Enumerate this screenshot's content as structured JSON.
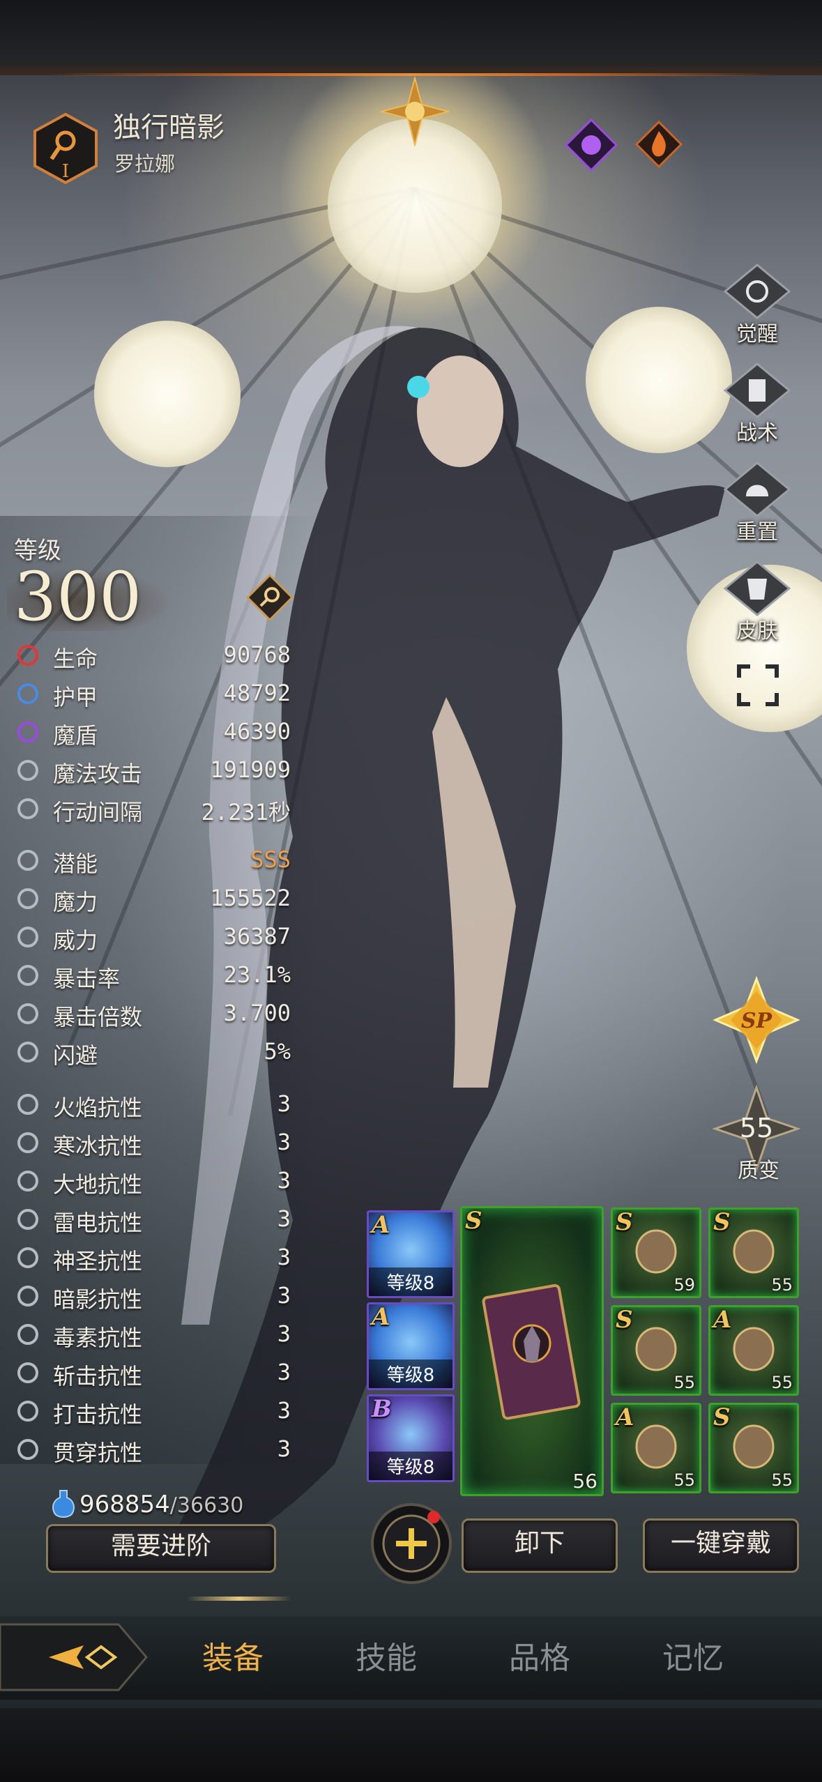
{
  "header": {
    "class_badge": "I",
    "hero_title": "独行暗影",
    "hero_name": "罗拉娜",
    "element_icons": [
      "shadow-icon",
      "fire-icon"
    ]
  },
  "side_buttons": [
    {
      "label": "觉醒",
      "icon": "sun-icon"
    },
    {
      "label": "战术",
      "icon": "tower-icon"
    },
    {
      "label": "重置",
      "icon": "helmet-icon"
    },
    {
      "label": "皮肤",
      "icon": "armor-icon"
    }
  ],
  "level": {
    "label": "等级",
    "value": "300"
  },
  "stats_primary": [
    {
      "name": "生命",
      "value": "90768",
      "icon": "health-cross-icon",
      "color": "#e0383a"
    },
    {
      "name": "护甲",
      "value": "48792",
      "icon": "shield-icon",
      "color": "#4a8ae0"
    },
    {
      "name": "魔盾",
      "value": "46390",
      "icon": "magic-shield-icon",
      "color": "#9a4ae0"
    },
    {
      "name": "魔法攻击",
      "value": "191909",
      "icon": "wand-icon",
      "color": "#b8bcc2"
    },
    {
      "name": "行动间隔",
      "value": "2.231秒",
      "icon": "wing-icon",
      "color": "#b8bcc2"
    }
  ],
  "stats_secondary": [
    {
      "name": "潜能",
      "value": "SSS",
      "icon": "person-icon"
    },
    {
      "name": "魔力",
      "value": "155522",
      "icon": "swirl-icon"
    },
    {
      "name": "威力",
      "value": "36387",
      "icon": "fist-icon"
    },
    {
      "name": "暴击率",
      "value": "23.1%",
      "icon": "burst-icon"
    },
    {
      "name": "暴击倍数",
      "value": "3.700",
      "icon": "arrow-icon"
    },
    {
      "name": "闪避",
      "value": "5%",
      "icon": "foot-icon"
    }
  ],
  "resistances": [
    {
      "name": "火焰抗性",
      "value": "3",
      "icon": "flame-icon"
    },
    {
      "name": "寒冰抗性",
      "value": "3",
      "icon": "snowflake-icon"
    },
    {
      "name": "大地抗性",
      "value": "3",
      "icon": "earth-icon"
    },
    {
      "name": "雷电抗性",
      "value": "3",
      "icon": "lightning-icon"
    },
    {
      "name": "神圣抗性",
      "value": "3",
      "icon": "holy-icon"
    },
    {
      "name": "暗影抗性",
      "value": "3",
      "icon": "shadow-icon"
    },
    {
      "name": "毒素抗性",
      "value": "3",
      "icon": "poison-icon"
    },
    {
      "name": "斩击抗性",
      "value": "3",
      "icon": "slash-icon"
    },
    {
      "name": "打击抗性",
      "value": "3",
      "icon": "blunt-icon"
    },
    {
      "name": "贯穿抗性",
      "value": "3",
      "icon": "pierce-icon"
    }
  ],
  "currency": {
    "current": "968854",
    "required": "/36630",
    "icon": "potion-icon"
  },
  "advance_button": "需要进阶",
  "sp_badge": "SP",
  "transmute": {
    "value": "55",
    "label": "质变"
  },
  "runes": [
    {
      "grade": "A",
      "level": "等级8",
      "color": "#3a7ad8"
    },
    {
      "grade": "A",
      "level": "等级8",
      "color": "#3a7ad8"
    },
    {
      "grade": "B",
      "level": "等级8",
      "color": "#5a4ab0"
    }
  ],
  "main_item": {
    "grade": "S",
    "level": "56",
    "icon": "spellbook-icon"
  },
  "equipment": [
    {
      "grade": "S",
      "level": "59",
      "icon": "skull-amulet-icon"
    },
    {
      "grade": "S",
      "level": "55",
      "icon": "chest-armor-icon"
    },
    {
      "grade": "S",
      "level": "55",
      "icon": "gauntlet-icon"
    },
    {
      "grade": "A",
      "level": "55",
      "icon": "ring-icon"
    },
    {
      "grade": "A",
      "level": "55",
      "icon": "bracelet-icon"
    },
    {
      "grade": "S",
      "level": "55",
      "icon": "boots-icon"
    }
  ],
  "actions": {
    "unequip": "卸下",
    "auto_equip": "一键穿戴"
  },
  "nav": {
    "tabs": [
      "装备",
      "技能",
      "品格",
      "记忆"
    ],
    "active": "装备"
  },
  "colors": {
    "accent": "#e8a040",
    "equip_green": "#3fa02a",
    "gold": "#f2c25c"
  }
}
